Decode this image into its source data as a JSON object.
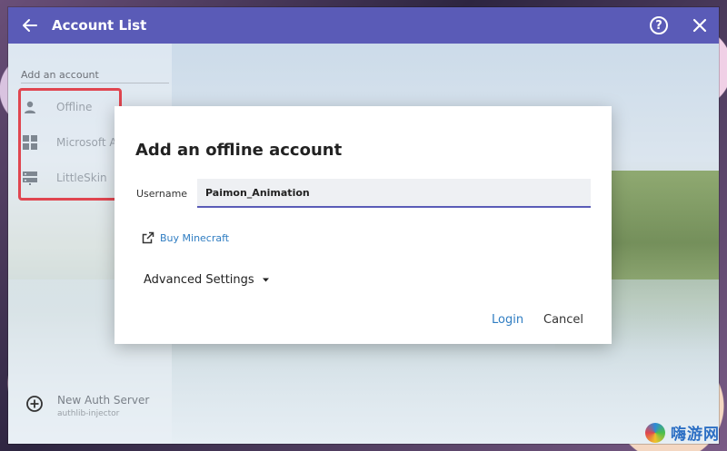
{
  "titlebar": {
    "title": "Account List",
    "help_glyph": "?",
    "back_icon": "arrow-left-icon",
    "close_icon": "close-icon"
  },
  "sidebar": {
    "add_account_label": "Add an account",
    "items": [
      {
        "label": "Offline",
        "icon": "person-icon"
      },
      {
        "label": "Microsoft A",
        "icon": "windows-icon"
      },
      {
        "label": "LittleSkin",
        "icon": "server-icon"
      }
    ],
    "new_auth": {
      "label": "New Auth Server",
      "sublabel": "authlib-injector",
      "icon": "add-circle-icon"
    }
  },
  "dialog": {
    "title": "Add an offline account",
    "username_label": "Username",
    "username_value": "Paimon_Animation",
    "buy_label": "Buy Minecraft",
    "advanced_label": "Advanced Settings",
    "login_label": "Login",
    "cancel_label": "Cancel"
  },
  "watermark": {
    "text": "嗨游网"
  },
  "colors": {
    "accent": "#5a5bb7",
    "link": "#2f7dc2",
    "highlight": "#e0454f"
  }
}
